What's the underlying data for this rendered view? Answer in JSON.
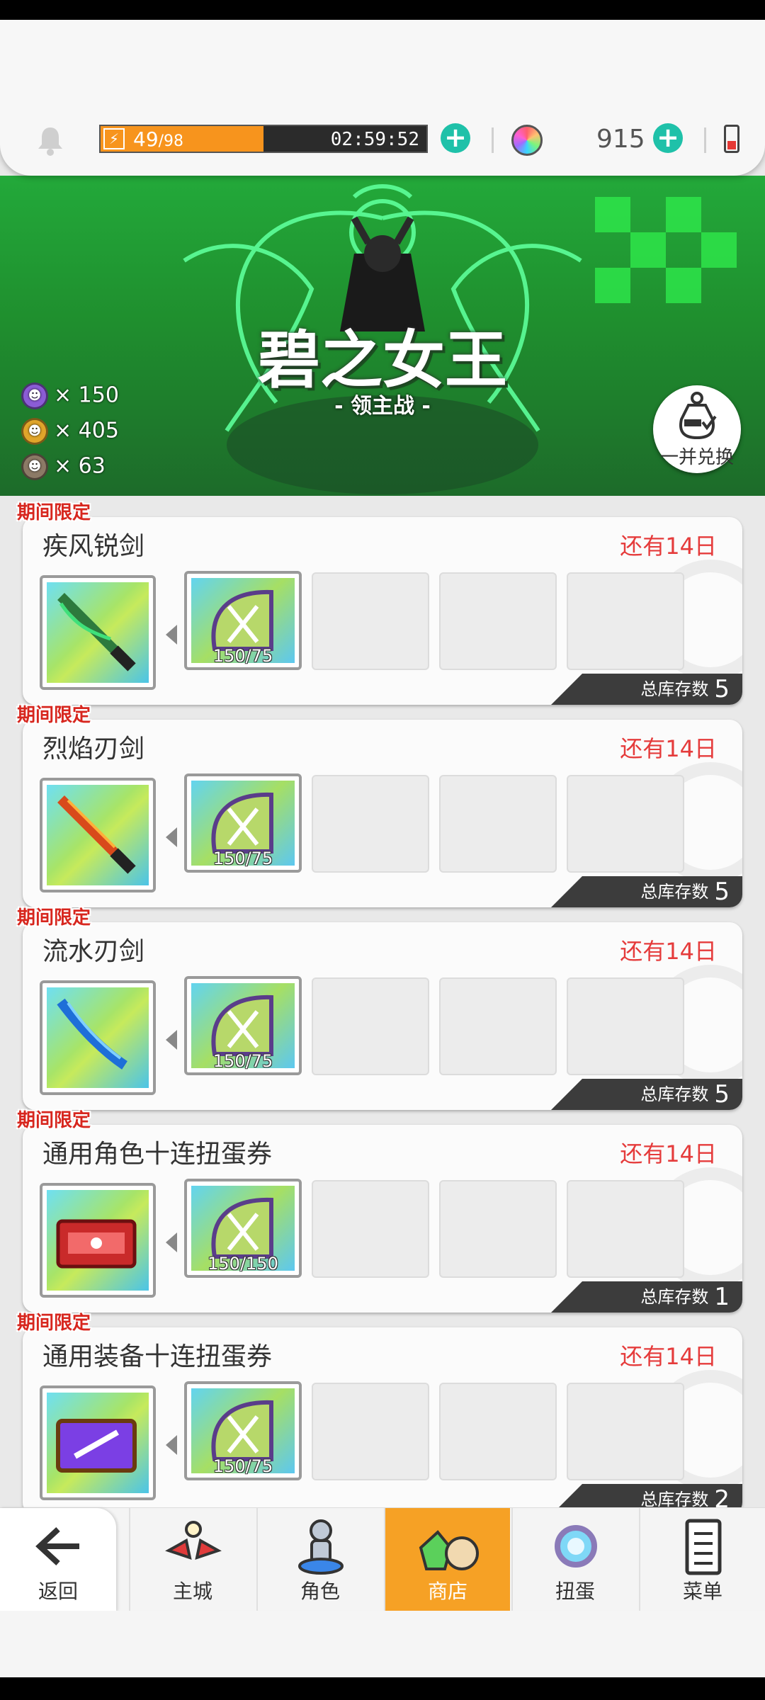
{
  "header": {
    "stamina": {
      "current": "49",
      "max": "/98",
      "fill": 0.5,
      "timer": "02:59:52"
    },
    "gems": "915"
  },
  "banner": {
    "title": "碧之女王",
    "subtitle": "- 领主战 -",
    "currencies": [
      {
        "icon": "purple-demon-medal-icon",
        "color": "#8b5cd6",
        "text": "× 150"
      },
      {
        "icon": "gold-demon-medal-icon",
        "color": "#e0a52a",
        "text": "× 405"
      },
      {
        "icon": "bronze-demon-medal-icon",
        "color": "#8c7a66",
        "text": "× 63"
      }
    ],
    "exchange_all": "一并兑换"
  },
  "shop": {
    "stock_label": "总库存数",
    "items": [
      {
        "tag": "期间限定",
        "name": "疾风锐剑",
        "remaining": "还有14日",
        "cost": "150/75",
        "stock": "5",
        "icon": "wind-sword-icon",
        "accent": "#2d7a3d"
      },
      {
        "tag": "期间限定",
        "name": "烈焰刃剑",
        "remaining": "还有14日",
        "cost": "150/75",
        "stock": "5",
        "icon": "flame-sword-icon",
        "accent": "#d84a1b"
      },
      {
        "tag": "期间限定",
        "name": "流水刃剑",
        "remaining": "还有14日",
        "cost": "150/75",
        "stock": "5",
        "icon": "water-sword-icon",
        "accent": "#1e6fd8"
      },
      {
        "tag": "期间限定",
        "name": "通用角色十连扭蛋券",
        "remaining": "还有14日",
        "cost": "150/150",
        "stock": "1",
        "icon": "character-ticket-icon",
        "accent": "#c92a2a"
      },
      {
        "tag": "期间限定",
        "name": "通用装备十连扭蛋券",
        "remaining": "还有14日",
        "cost": "150/75",
        "stock": "2",
        "icon": "equipment-ticket-icon",
        "accent": "#7b3fe4"
      }
    ]
  },
  "nav": {
    "back": "返回",
    "items": [
      {
        "label": "主城",
        "icon": "castle-icon"
      },
      {
        "label": "角色",
        "icon": "character-icon"
      },
      {
        "label": "商店",
        "icon": "shop-icon",
        "active": true
      },
      {
        "label": "扭蛋",
        "icon": "gacha-icon"
      },
      {
        "label": "菜单",
        "icon": "menu-icon"
      }
    ]
  }
}
